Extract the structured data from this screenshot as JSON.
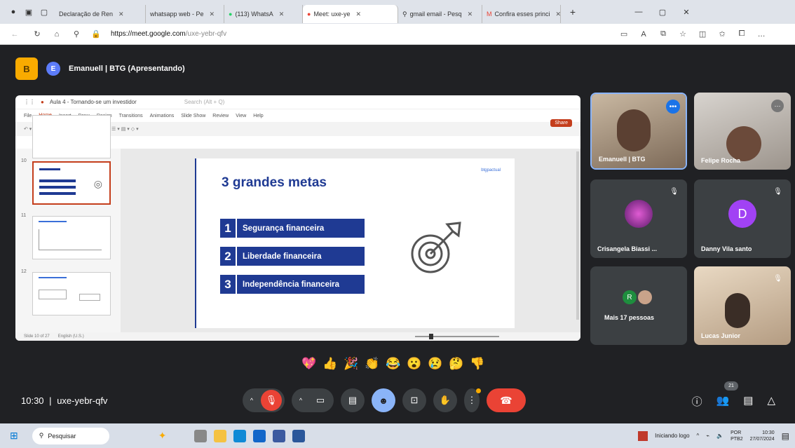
{
  "browser": {
    "tabs": [
      {
        "label": "Declaração de Ren"
      },
      {
        "label": "whatsapp web - Pe"
      },
      {
        "label": "(113) WhatsA"
      },
      {
        "label": "Meet: uxe-ye"
      },
      {
        "label": "gmail email - Pesq"
      },
      {
        "label": "Confira esses princi"
      }
    ],
    "active_tab_index": 3,
    "url_host": "https://meet.google.com",
    "url_path": "/uxe-yebr-qfv"
  },
  "meet": {
    "presenter_label": "Emanuell | BTG (Apresentando)",
    "presenter_initial": "E",
    "app_badge": "B",
    "slide": {
      "title": "3 grandes metas",
      "logo_text": "btgpactual",
      "goals": [
        {
          "num": "1",
          "label": "Segurança financeira"
        },
        {
          "num": "2",
          "label": "Liberdade financeira"
        },
        {
          "num": "3",
          "label": "Independência financeira"
        }
      ]
    },
    "ppt": {
      "doc_title": "Aula 4 - Tornando-se um investidor",
      "search_placeholder": "Search (Alt + Q)",
      "menu": [
        "File",
        "Home",
        "Insert",
        "Draw",
        "Design",
        "Transitions",
        "Animations",
        "Slide Show",
        "Review",
        "View",
        "Help"
      ],
      "share_label": "Share",
      "status_left": "Slide 10 of 27",
      "status_lang": "English (U.S.)"
    },
    "participants": [
      {
        "name": "Emanuell | BTG"
      },
      {
        "name": "Felipe Rocha"
      },
      {
        "name": "Crisangela Biassi ..."
      },
      {
        "name": "Danny Vila santo",
        "initial": "D"
      },
      {
        "name": "Mais 17 pessoas",
        "initial": "R"
      },
      {
        "name": "Lucas Junior"
      }
    ],
    "reactions": [
      "💖",
      "👍",
      "🎉",
      "👏",
      "😂",
      "😮",
      "😢",
      "🤔",
      "👎"
    ],
    "time": "10:30",
    "meeting_code": "uxe-yebr-qfv",
    "people_count": "21"
  },
  "taskbar": {
    "search_placeholder": "Pesquisar",
    "notification": "Iniciando logo",
    "lang": "POR",
    "lang_sub": "PTB2",
    "clock_time": "10:30",
    "clock_date": "27/07/2024"
  }
}
